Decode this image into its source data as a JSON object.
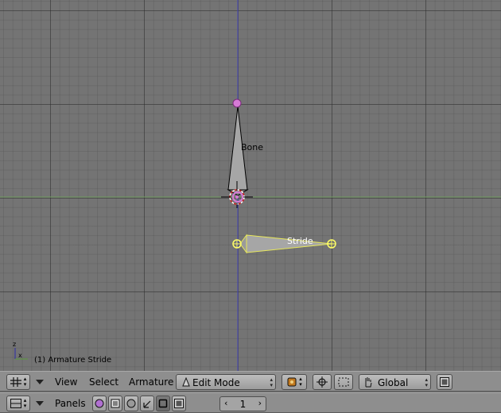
{
  "viewport": {
    "bone_label": "Bone",
    "stride_label": "Stride",
    "status_text": "(1) Armature Stride",
    "axis_gizmo": {
      "x_label": "x",
      "z_label": "z"
    }
  },
  "header1": {
    "menus": [
      "View",
      "Select",
      "Armature"
    ],
    "mode_value": "Edit Mode",
    "orientation_value": "Global"
  },
  "header2": {
    "panels_label": "Panels",
    "frame_value": "1"
  },
  "colors": {
    "viewport_bg": "#747474",
    "grid_line": "#4a4a4a",
    "x_axis": "#7a9a6a",
    "z_axis": "#4a4aa8",
    "bone_fill": "#a8a8a8",
    "selected_yellow": "#ffff66",
    "joint_pink": "#e070e0"
  }
}
